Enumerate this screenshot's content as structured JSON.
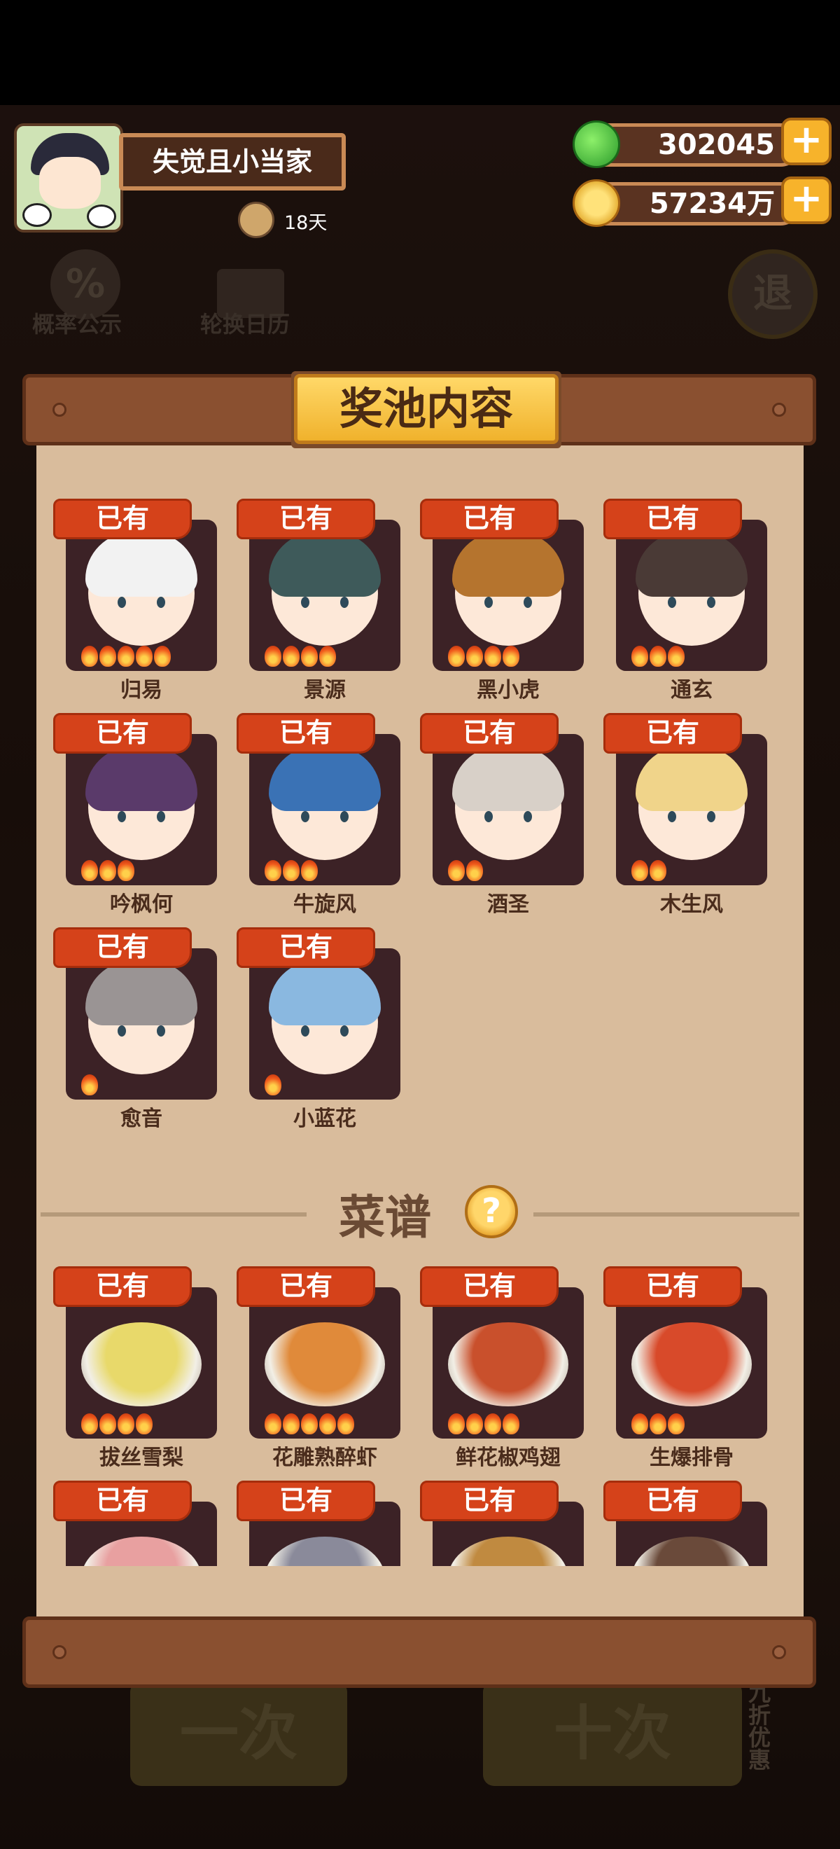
{
  "header": {
    "player_name": "失觉且小当家",
    "days": "18天",
    "jade": "302045",
    "coins": "57234万",
    "plus": "+"
  },
  "background": {
    "probability": "概率公示",
    "calendar": "轮换日历",
    "exit": "退",
    "single_draw": "一次",
    "ten_draw": "十次",
    "discount": "九折优惠"
  },
  "panel": {
    "title": "奖池内容",
    "owned_label": "已有",
    "characters": [
      {
        "name": "归易",
        "flames": 5
      },
      {
        "name": "景源",
        "flames": 4
      },
      {
        "name": "黑小虎",
        "flames": 4
      },
      {
        "name": "通玄",
        "flames": 3
      },
      {
        "name": "吟枫何",
        "flames": 3
      },
      {
        "name": "牛旋风",
        "flames": 3
      },
      {
        "name": "酒圣",
        "flames": 2
      },
      {
        "name": "木生风",
        "flames": 2
      },
      {
        "name": "愈音",
        "flames": 1
      },
      {
        "name": "小蓝花",
        "flames": 1
      }
    ],
    "recipe_section_title": "菜谱",
    "help": "?",
    "recipes": [
      {
        "name": "拔丝雪梨",
        "flames": 4
      },
      {
        "name": "花雕熟醉虾",
        "flames": 5
      },
      {
        "name": "鲜花椒鸡翅",
        "flames": 4
      },
      {
        "name": "生爆排骨",
        "flames": 3
      },
      {
        "name": "",
        "flames": 0
      },
      {
        "name": "",
        "flames": 0
      },
      {
        "name": "",
        "flames": 0
      },
      {
        "name": "",
        "flames": 0
      }
    ]
  },
  "colors": {
    "badge": "#d5421a",
    "card": "#3c2226",
    "panel": "#d9bc9c",
    "board": "#8a5030",
    "title": "#f0b22c"
  },
  "icons": {
    "jade": "jade-coin-icon",
    "coin": "gold-coin-icon",
    "plus": "plus-icon",
    "help": "question-icon",
    "flame": "flame-icon"
  }
}
